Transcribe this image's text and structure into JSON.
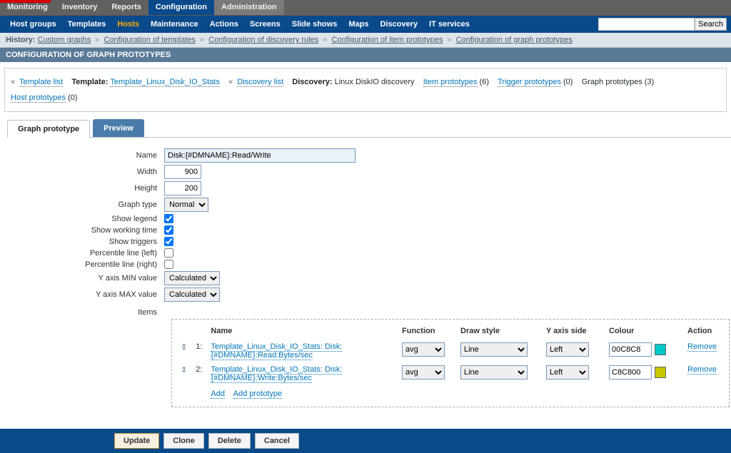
{
  "mainTabs": [
    "Monitoring",
    "Inventory",
    "Reports",
    "Configuration",
    "Administration"
  ],
  "mainTabActive": 3,
  "subnav": [
    "Host groups",
    "Templates",
    "Hosts",
    "Maintenance",
    "Actions",
    "Screens",
    "Slide shows",
    "Maps",
    "Discovery",
    "IT services"
  ],
  "subnavActive": 2,
  "searchLabel": "Search",
  "history": {
    "label": "History:",
    "items": [
      "Custom graphs",
      "Configuration of templates",
      "Configuration of discovery rules",
      "Configuration of item prototypes",
      "Configuration of graph prototypes"
    ]
  },
  "pageTitle": "CONFIGURATION OF GRAPH PROTOTYPES",
  "hostBox": {
    "templateListLabel": "Template list",
    "templateLabel": "Template:",
    "templateLink": "Template_Linux_Disk_IO_Stats",
    "discoveryListLabel": "Discovery list",
    "discoveryLabel": "Discovery:",
    "discoveryName": "Linux DiskIO discovery",
    "itemPrototypes": "Item prototypes",
    "itemPrototypesCount": "(6)",
    "triggerPrototypes": "Trigger prototypes",
    "triggerPrototypesCount": "(0)",
    "graphPrototypes": "Graph prototypes",
    "graphPrototypesCount": "(3)",
    "hostPrototypes": "Host prototypes",
    "hostPrototypesCount": "(0)"
  },
  "formTabs": {
    "graphProto": "Graph prototype",
    "preview": "Preview"
  },
  "form": {
    "nameLabel": "Name",
    "nameValue": "Disk:{#DMNAME}:Read/Write",
    "widthLabel": "Width",
    "widthValue": "900",
    "heightLabel": "Height",
    "heightValue": "200",
    "graphTypeLabel": "Graph type",
    "graphTypeValue": "Normal",
    "showLegendLabel": "Show legend",
    "showWorkingLabel": "Show working time",
    "showTriggersLabel": "Show triggers",
    "percLeftLabel": "Percentile line (left)",
    "percRightLabel": "Percentile line (right)",
    "yminLabel": "Y axis MIN value",
    "yminValue": "Calculated",
    "ymaxLabel": "Y axis MAX value",
    "ymaxValue": "Calculated",
    "itemsLabel": "Items"
  },
  "itemsTable": {
    "headers": {
      "name": "Name",
      "function": "Function",
      "draw": "Draw style",
      "yaxis": "Y axis side",
      "colour": "Colour",
      "action": "Action"
    },
    "rows": [
      {
        "idx": "1:",
        "name": "Template_Linux_Disk_IO_Stats: Disk:{#DMNAME}:Read:Bytes/sec",
        "func": "avg",
        "draw": "Line",
        "side": "Left",
        "colour": "00C8C8",
        "swatch": "#00C8C8",
        "action": "Remove"
      },
      {
        "idx": "2:",
        "name": "Template_Linux_Disk_IO_Stats: Disk:{#DMNAME}:Write:Bytes/sec",
        "func": "avg",
        "draw": "Line",
        "side": "Left",
        "colour": "C8C800",
        "swatch": "#C8C800",
        "action": "Remove"
      }
    ],
    "addLabel": "Add",
    "addProtoLabel": "Add prototype"
  },
  "footer": {
    "update": "Update",
    "clone": "Clone",
    "delete": "Delete",
    "cancel": "Cancel"
  }
}
